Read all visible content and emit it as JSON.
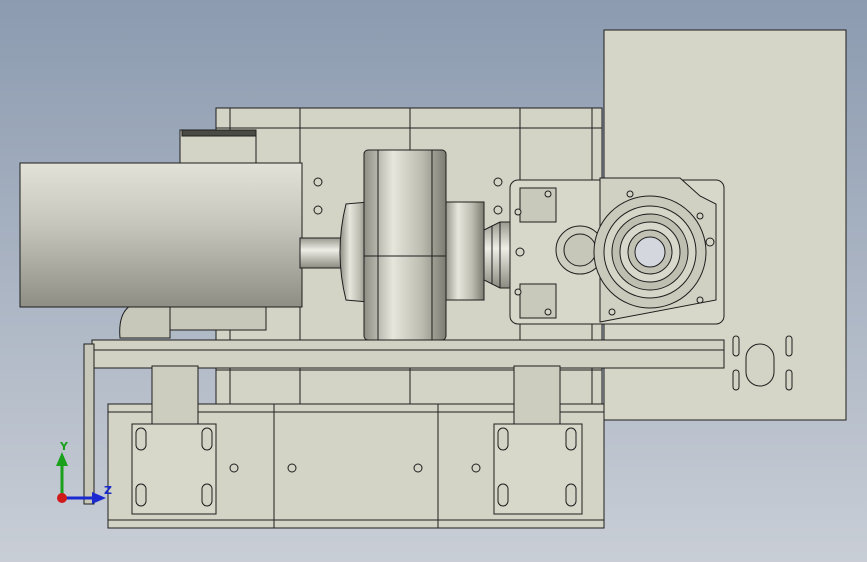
{
  "viewport": {
    "background_top": "#8c9bb0",
    "background_bottom": "#c9ced6"
  },
  "colors": {
    "part_fill": "#d4d4c6",
    "part_shade": "#bdbdae",
    "edge": "#1e1e1e",
    "motor_light": "#e2e2d8",
    "motor_dark": "#8e8e84"
  },
  "triad": {
    "y_label": "Y",
    "z_label": "Z",
    "x_color": "#d01a1a",
    "y_color": "#1aa01a",
    "z_color": "#1a2ad0"
  }
}
